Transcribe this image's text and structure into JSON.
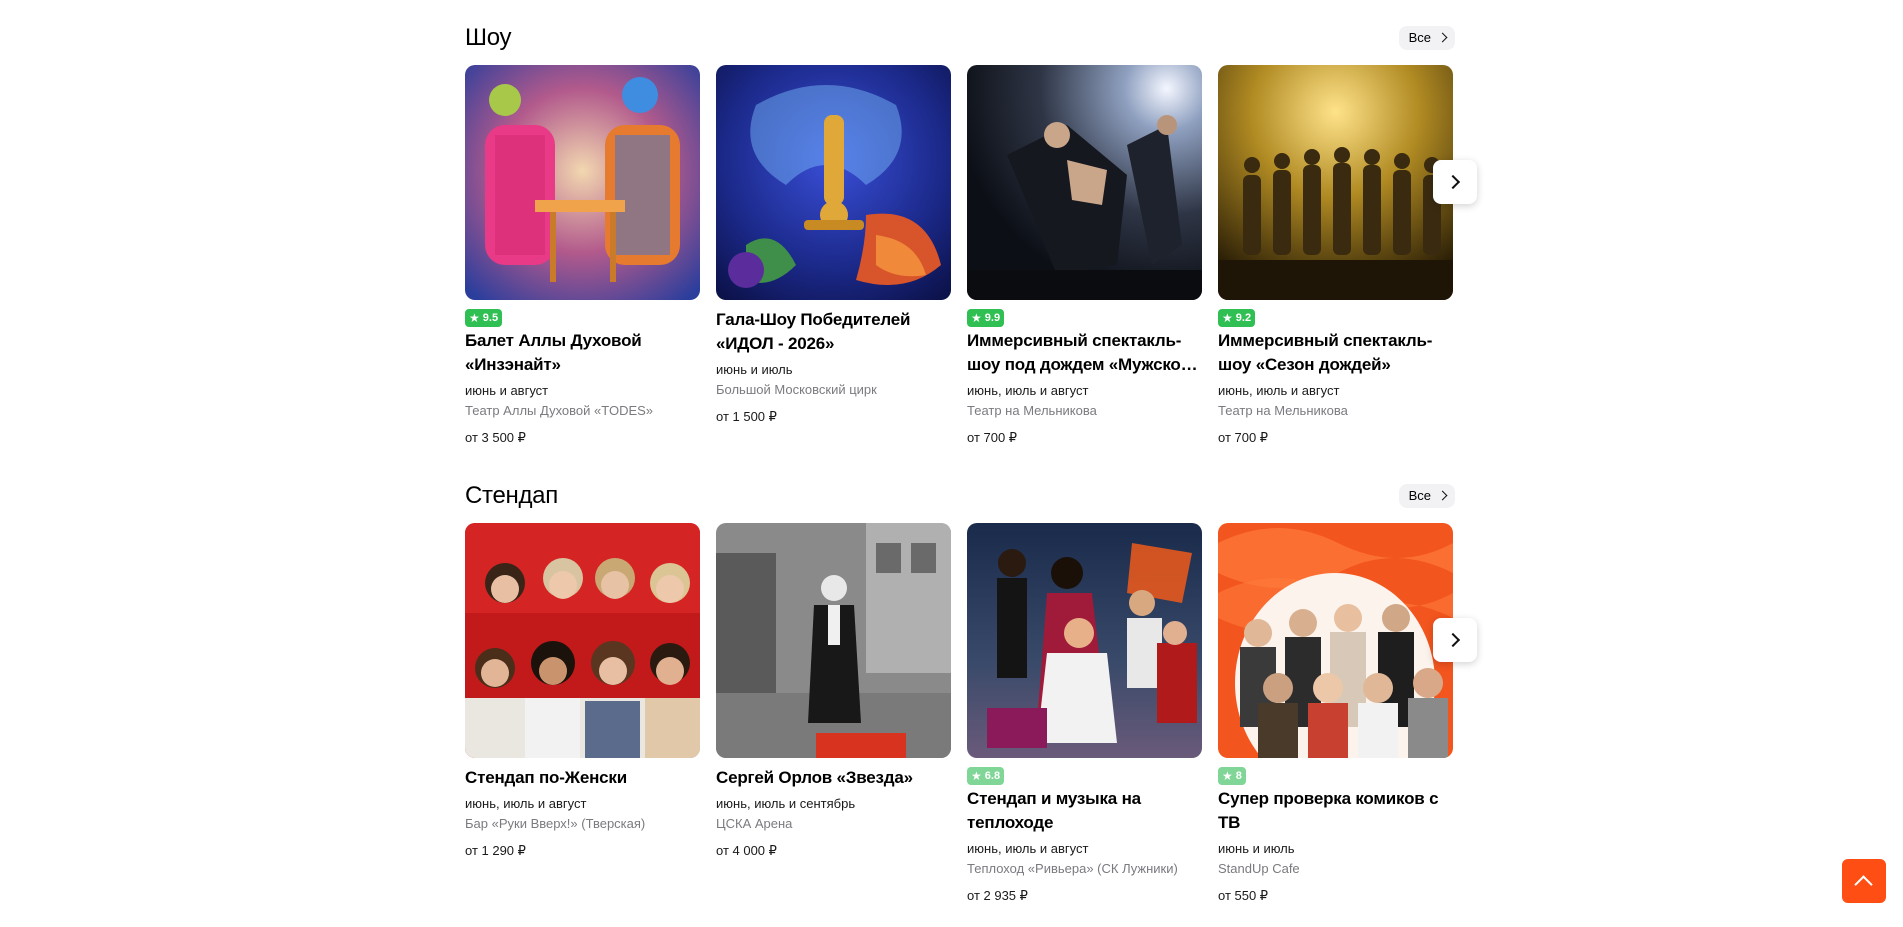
{
  "sections": [
    {
      "title": "Шоу",
      "all_label": "Все",
      "cards": [
        {
          "rating": "9.5",
          "title": "Балет Аллы Духовой «Инзэнайт»",
          "date": "июнь и август",
          "venue": "Театр Аллы Духовой «TODES»",
          "price": "от 3 500 ₽"
        },
        {
          "rating": "",
          "title": "Гала-Шоу Победителей «ИДОЛ - 2026»",
          "date": "июнь и июль",
          "venue": "Большой Московский цирк",
          "price": "от 1 500 ₽"
        },
        {
          "rating": "9.9",
          "title": "Иммерсивный спектакль-шоу под дождем «Мужской дождь»",
          "date": "июнь, июль и август",
          "venue": "Театр на Мельникова",
          "price": "от 700 ₽"
        },
        {
          "rating": "9.2",
          "title": "Иммерсивный спектакль-шоу «Сезон дождей»",
          "date": "июнь, июль и август",
          "venue": "Театр на Мельникова",
          "price": "от 700 ₽"
        }
      ]
    },
    {
      "title": "Стендап",
      "all_label": "Все",
      "cards": [
        {
          "rating": "",
          "title": "Стендап по-Женски",
          "date": "июнь, июль и август",
          "venue": "Бар «Руки Вверх!» (Тверская)",
          "price": "от 1 290 ₽"
        },
        {
          "rating": "",
          "title": "Сергей Орлов «Звезда»",
          "date": "июнь, июль и сентябрь",
          "venue": "ЦСКА Арена",
          "price": "от 4 000 ₽"
        },
        {
          "rating": "6.8",
          "title": "Стендап и музыка на теплоходе",
          "date": "июнь, июль и август",
          "venue": "Теплоход «Ривьера» (СК Лужники)",
          "price": "от 2 935 ₽"
        },
        {
          "rating": "8",
          "title": "Супер проверка комиков с ТВ",
          "date": "июнь и июль",
          "venue": "StandUp Cafe",
          "price": "от 550 ₽"
        }
      ]
    }
  ],
  "icons": {
    "star": "star-icon",
    "chevron": "chevron-right-icon",
    "scroll_top": "chevron-up-icon"
  },
  "colors": {
    "accent": "#ff4e14",
    "rating_high": "#2fbf52",
    "rating_mid": "#7fd696",
    "muted_text": "#7a7a80"
  }
}
